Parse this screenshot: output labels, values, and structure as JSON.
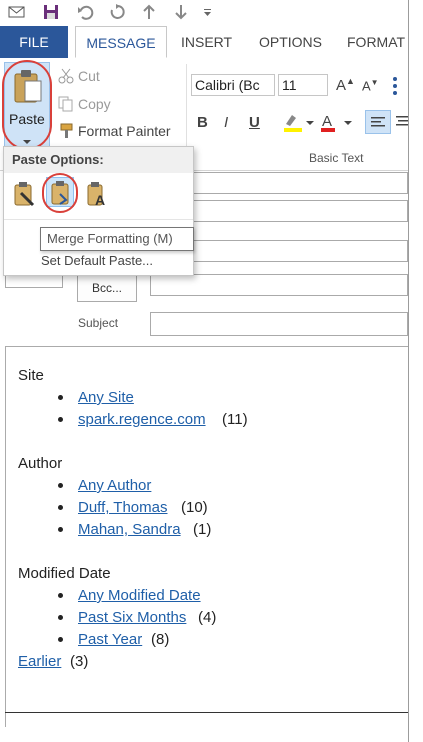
{
  "tabs": {
    "file": "FILE",
    "message": "MESSAGE",
    "insert": "INSERT",
    "options": "OPTIONS",
    "format": "FORMAT"
  },
  "clipboard": {
    "paste": "Paste",
    "cut": "Cut",
    "copy": "Copy",
    "format_painter": "Format Painter"
  },
  "font": {
    "name": "Calibri (Bc",
    "size": "11",
    "group_label": "Basic Text"
  },
  "paste_menu": {
    "header": "Paste Options:",
    "set_default": "Set Default Paste...",
    "tooltip": "Merge Formatting (M)"
  },
  "fields": {
    "bcc": "Bcc...",
    "subject": "Subject"
  },
  "body": {
    "site_heading": "Site",
    "any_site": "Any Site",
    "spark": "spark.regence.com",
    "spark_count": "(11)",
    "author_heading": "Author",
    "any_author": "Any Author",
    "duff": "Duff, Thomas",
    "duff_count": "(10)",
    "mahan": "Mahan, Sandra",
    "mahan_count": "(1)",
    "modified_heading": "Modified Date",
    "any_modified": "Any Modified Date",
    "past_six": "Past Six Months",
    "past_six_count": "(4)",
    "past_year": "Past Year",
    "past_year_count": "(8)",
    "earlier": "Earlier",
    "earlier_count": "(3)"
  },
  "colors": {
    "accent": "#2b579a",
    "link": "#1f5fa8",
    "highlight_red": "#d9403a"
  }
}
